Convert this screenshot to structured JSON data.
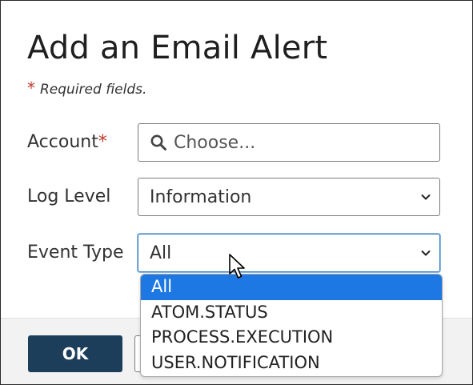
{
  "dialog": {
    "title": "Add an Email Alert",
    "required_star": "*",
    "required_note": "Required fields."
  },
  "fields": {
    "account": {
      "label": "Account",
      "required_star": "*",
      "placeholder": "Choose...",
      "icon": "search-icon"
    },
    "log_level": {
      "label": "Log Level",
      "value": "Information",
      "icon": "chevron-down-icon"
    },
    "event_type": {
      "label": "Event Type",
      "value": "All",
      "icon": "chevron-down-icon",
      "options": [
        "All",
        "ATOM.STATUS",
        "PROCESS.EXECUTION",
        "USER.NOTIFICATION"
      ],
      "highlighted_option": "All"
    }
  },
  "footer": {
    "ok_label": "OK"
  },
  "colors": {
    "primary_button": "#1d3e5b",
    "required": "#c0392b",
    "selection": "#1e78e3",
    "focus": "#3a7fc0"
  }
}
